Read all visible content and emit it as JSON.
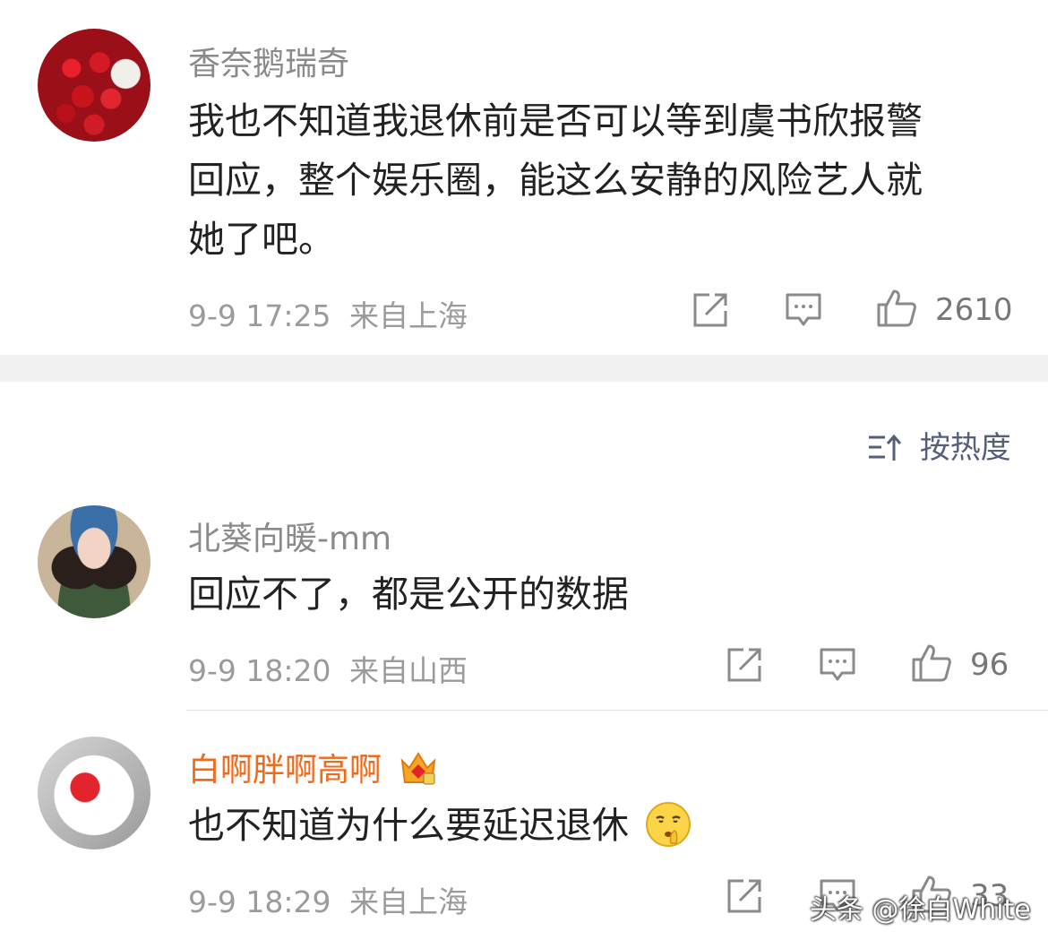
{
  "comments": [
    {
      "username": "香奈鹅瑞奇",
      "text_lines": [
        "我也不知道我退休前是否可以等到虞书欣报警",
        "回应，整个娱乐圈，能这么安静的风险艺人就",
        "她了吧。"
      ],
      "time": "9-9 17:25",
      "location": "来自上海",
      "likes": "2610"
    },
    {
      "username": "北葵向暖-mm",
      "text_lines": [
        "回应不了，都是公开的数据"
      ],
      "time": "9-9 18:20",
      "location": "来自山西",
      "likes": "96"
    },
    {
      "username": "白啊胖啊高啊",
      "text_lines": [
        "也不知道为什么要延迟退休"
      ],
      "time": "9-9 18:29",
      "location": "来自上海",
      "likes": "33"
    }
  ],
  "sort": {
    "label": "按热度"
  },
  "watermark": "头条 @徐白White",
  "colors": {
    "vip_name": "#ef6a1a",
    "sort_text": "#555f78",
    "meta": "#9b9b9b"
  }
}
